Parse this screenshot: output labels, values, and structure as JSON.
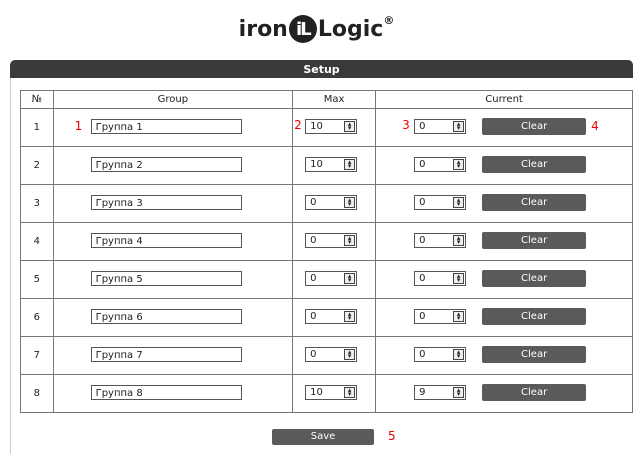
{
  "logo": {
    "left": "iron",
    "badge": "iL",
    "right": "Logic",
    "reg": "®"
  },
  "section_title": "Setup",
  "columns": {
    "num": "№",
    "group": "Group",
    "max": "Max",
    "current": "Current"
  },
  "rows": [
    {
      "num": "1",
      "group": "Группа 1",
      "max": "10",
      "current": "0"
    },
    {
      "num": "2",
      "group": "Группа 2",
      "max": "10",
      "current": "0"
    },
    {
      "num": "3",
      "group": "Группа 3",
      "max": "0",
      "current": "0"
    },
    {
      "num": "4",
      "group": "Группа 4",
      "max": "0",
      "current": "0"
    },
    {
      "num": "5",
      "group": "Группа 5",
      "max": "0",
      "current": "0"
    },
    {
      "num": "6",
      "group": "Группа 6",
      "max": "0",
      "current": "0"
    },
    {
      "num": "7",
      "group": "Группа 7",
      "max": "0",
      "current": "0"
    },
    {
      "num": "8",
      "group": "Группа 8",
      "max": "10",
      "current": "9"
    }
  ],
  "clear_label": "Clear",
  "save_label": "Save",
  "annotations": {
    "a1": "1",
    "a2": "2",
    "a3": "3",
    "a4": "4",
    "a5": "5"
  },
  "spinner_icon": "spin-updown-icon"
}
